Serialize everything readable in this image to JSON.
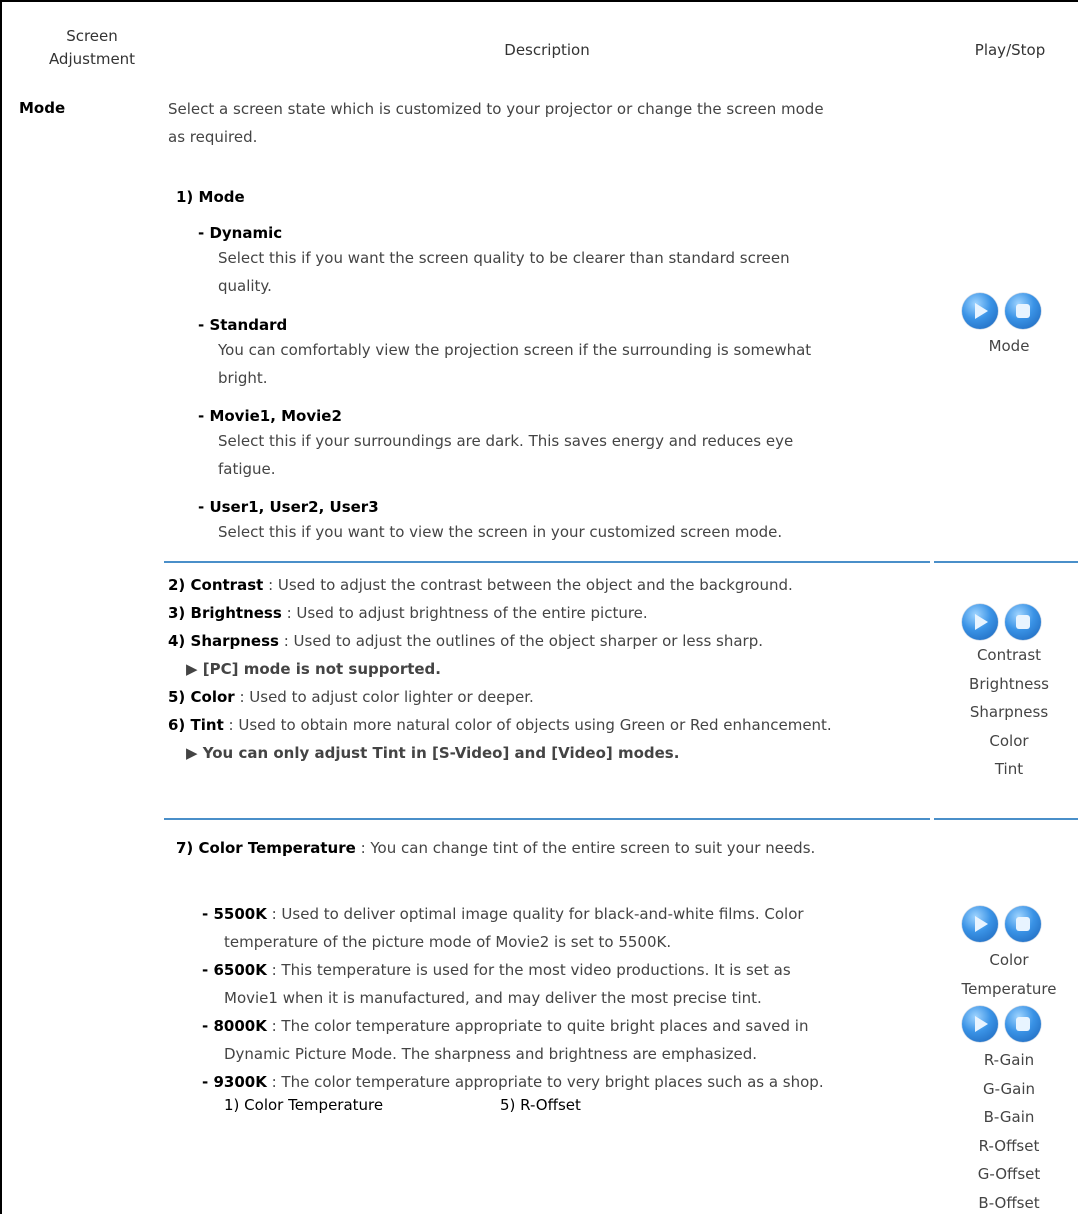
{
  "header": {
    "col1_line1": "Screen",
    "col1_line2": "Adjustment",
    "col2": "Description",
    "col3": "Play/Stop"
  },
  "row_name": "Mode",
  "intro_line1": "Select a screen state which is customized to your projector or change the screen mode",
  "intro_line2": "as required.",
  "mode_heading": "1) Mode",
  "dynamic": {
    "title": "- Dynamic",
    "line1": "Select this if you want the screen quality to be clearer than standard screen",
    "line2": "quality."
  },
  "standard": {
    "title": "- Standard",
    "line1": "You can comfortably view the projection screen if the surrounding is somewhat",
    "line2": "bright."
  },
  "movie": {
    "title": "- Movie1, Movie2",
    "line1": "Select this if your surroundings are dark. This saves energy and reduces eye",
    "line2": "fatigue."
  },
  "user": {
    "title": "- User1, User2, User3",
    "line1": "Select this if you want to view the screen in your customized screen mode."
  },
  "section2": {
    "contrast_label": "2) Contrast",
    "contrast_text": " : Used to adjust the contrast between the object and the background.",
    "brightness_label": "3) Brightness",
    "brightness_text": " : Used to adjust brightness of the entire picture.",
    "sharpness_label": "4) Sharpness",
    "sharpness_text": " : Used to adjust the outlines of the object sharper or less sharp.",
    "pc_note": "▶ [PC] mode is not supported.",
    "color_label": "5) Color",
    "color_text": " : Used to adjust color lighter or deeper.",
    "tint_label": "6) Tint",
    "tint_text": " : Used to obtain more natural color of objects using Green or Red enhancement.",
    "tint_note": "▶ You can only adjust Tint in [S-Video] and [Video] modes."
  },
  "section3": {
    "ct_label": "7) Color Temperature",
    "ct_text": " : You can change tint of the entire screen to suit your needs.",
    "k5500_label": "- 5500K",
    "k5500_line1": " : Used to deliver optimal image quality for black-and-white films. Color",
    "k5500_line2": "temperature of the picture mode of Movie2 is set to 5500K.",
    "k6500_label": "- 6500K",
    "k6500_line1": " : This temperature is used for the most video productions. It is set as",
    "k6500_line2": "Movie1 when it is manufactured, and may deliver the most precise tint.",
    "k8000_label": "- 8000K",
    "k8000_line1": " : The color temperature appropriate to quite bright places and saved in",
    "k8000_line2": "Dynamic Picture Mode. The sharpness and brightness are emphasized.",
    "k9300_label": "- 9300K",
    "k9300_line1": " : The color temperature appropriate to very bright places such as a shop.",
    "sub1": "1) Color Temperature",
    "sub5": "5) R-Offset"
  },
  "labels": {
    "mode": "Mode",
    "group2": [
      "Contrast",
      "Brightness",
      "Sharpness",
      "Color",
      "Tint"
    ],
    "group3a": [
      "Color",
      "Temperature"
    ],
    "group3b": [
      "R-Gain",
      "G-Gain",
      "B-Gain",
      "R-Offset",
      "G-Offset",
      "B-Offset"
    ]
  },
  "accent_color": "#4a8fc9"
}
